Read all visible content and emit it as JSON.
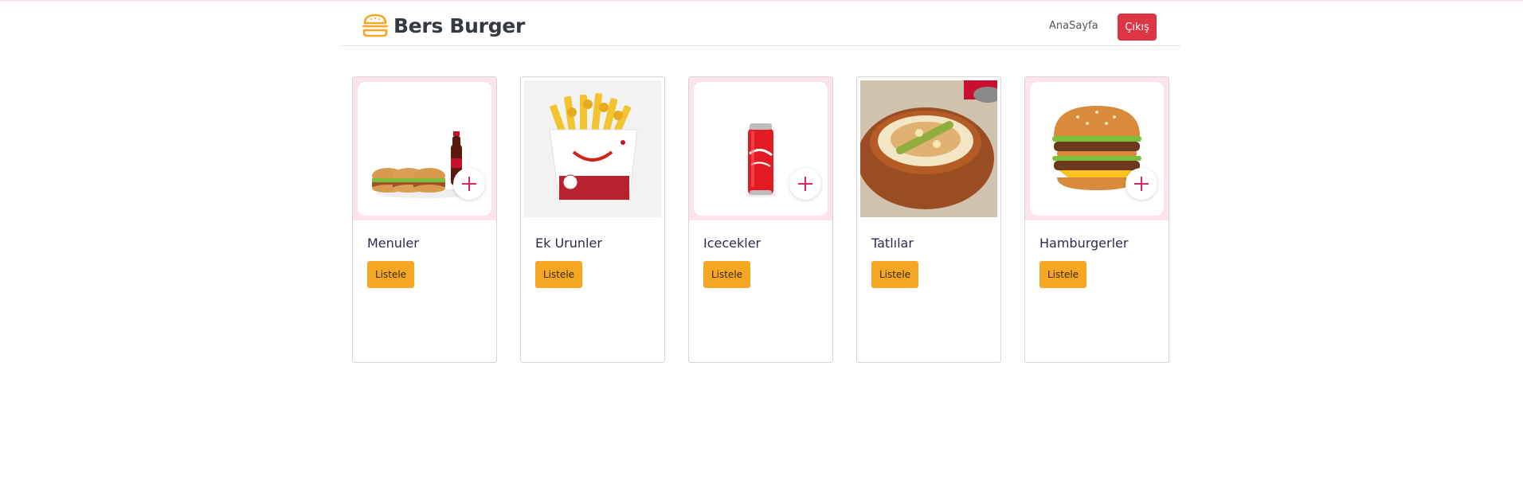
{
  "navbar": {
    "brand": "Bers Burger",
    "brand_icon": "burger-icon",
    "home_link": "AnaSayfa",
    "logout_button": "Çıkış",
    "logout_color": "#dc3545"
  },
  "categories": [
    {
      "title": "Menuler",
      "button": "Listele",
      "image": "burger-menu-with-cola"
    },
    {
      "title": "Ek Urunler",
      "button": "Listele",
      "image": "french-fries-box"
    },
    {
      "title": "Icecekler",
      "button": "Listele",
      "image": "cola-can"
    },
    {
      "title": "Tatlılar",
      "button": "Listele",
      "image": "rice-pudding-bowl"
    },
    {
      "title": "Hamburgerler",
      "button": "Listele",
      "image": "double-hamburger"
    }
  ],
  "colors": {
    "accent_button": "#f5a623",
    "plus_icon": "#e0245e",
    "card_highlight": "#fde4ea"
  }
}
